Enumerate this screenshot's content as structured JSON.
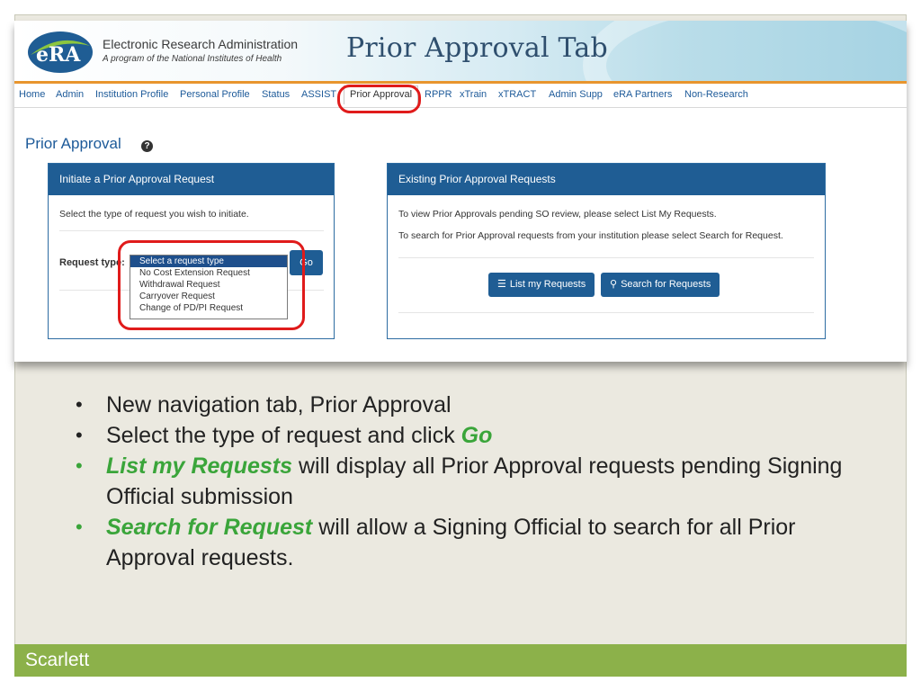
{
  "screenshot": {
    "org_title": "Electronic Research Administration",
    "org_subtitle": "A program of the National Institutes of Health",
    "logo_text": "eRA",
    "page_heading": "Prior Approval Tab",
    "nav": [
      "Home",
      "Admin",
      "Institution Profile",
      "Personal Profile",
      "Status",
      "ASSIST",
      "Prior Approval",
      "RPPR",
      "xTrain",
      "xTRACT",
      "Admin Supp",
      "eRA Partners",
      "Non-Research"
    ],
    "section_title": "Prior Approval",
    "help_icon": "?",
    "initiate_panel": {
      "title": "Initiate a Prior Approval Request",
      "instruction": "Select the type of request you wish to initiate.",
      "request_label": "Request type:",
      "options": [
        "Select a request type",
        "No Cost Extension Request",
        "Withdrawal Request",
        "Carryover Request",
        "Change of PD/PI Request"
      ],
      "go_label": "Go"
    },
    "existing_panel": {
      "title": "Existing Prior Approval Requests",
      "line1": "To view Prior Approvals pending SO review, please select List My Requests.",
      "line2": "To search for Prior Approval requests from your institution please select Search for Request.",
      "list_button": "List my Requests",
      "search_button": "Search for Requests"
    }
  },
  "bullets": {
    "b1": "New navigation tab, Prior Approval",
    "b2_text": "Select the type of request and click ",
    "b2_em": "Go",
    "b3_em": "List my Requests",
    "b3_text": " will display all Prior Approval requests pending Signing Official submission",
    "b4_em": "Search for Request",
    "b4_text": " will allow a Signing Official to search for all Prior Approval requests."
  },
  "footer": "Scarlett",
  "colors": {
    "accent_green": "#3aa53a",
    "highlight_red": "#e01b1b",
    "panel_blue": "#1f5d94",
    "footer_green": "#8cb14a"
  },
  "icons": [
    "help-icon",
    "list-icon",
    "search-icon"
  ]
}
